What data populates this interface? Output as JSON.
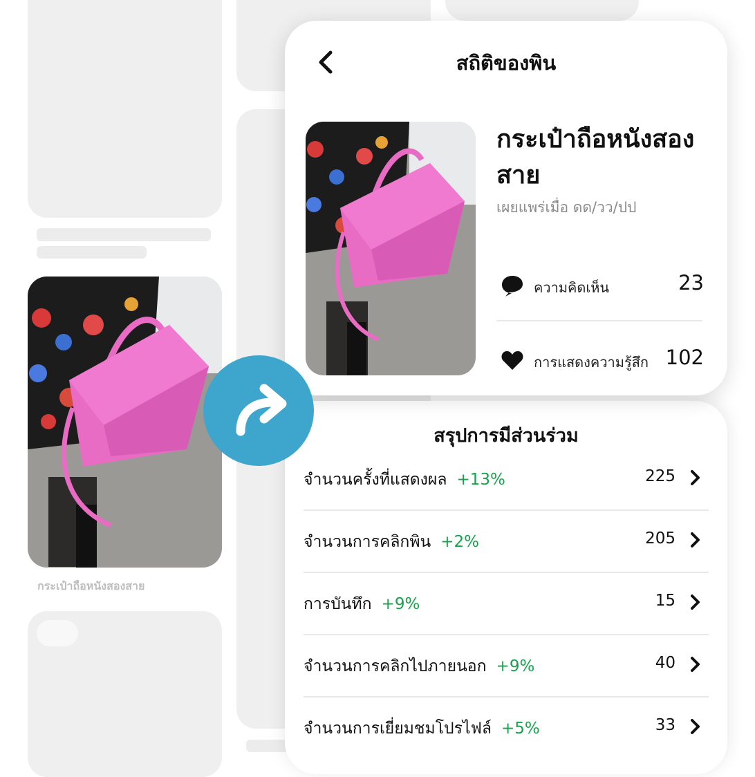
{
  "background_feed": {
    "pin_caption": "กระเป๋าถือหนังสองสาย"
  },
  "stats_card": {
    "title": "สถิติของพิน",
    "pin_title": "กระเป๋าถือหนังสองสาย",
    "published": "เผยแพร่เมื่อ ดด/วว/ปป",
    "stats": [
      {
        "icon": "comment-icon",
        "label": "ความคิดเห็น",
        "value": "23"
      },
      {
        "icon": "heart-icon",
        "label": "การแสดงความรู้สึก",
        "value": "102"
      }
    ]
  },
  "engagement": {
    "title": "สรุปการมีส่วนร่วม",
    "rows": [
      {
        "label": "จำนวนครั้งที่แสดงผล",
        "change": "+13%",
        "value": "225"
      },
      {
        "label": "จำนวนการคลิกพิน",
        "change": "+2%",
        "value": "205"
      },
      {
        "label": "การบันทึก",
        "change": "+9%",
        "value": "15"
      },
      {
        "label": "จำนวนการคลิกไปภายนอก",
        "change": "+9%",
        "value": "40"
      },
      {
        "label": "จำนวนการเยี่ยมชมโปรไฟล์",
        "change": "+5%",
        "value": "33"
      }
    ]
  },
  "colors": {
    "share_button": "#3ea6cd",
    "positive_change": "#16a34a",
    "placeholder": "#efefef",
    "bag_pink": "#e86cc4"
  }
}
